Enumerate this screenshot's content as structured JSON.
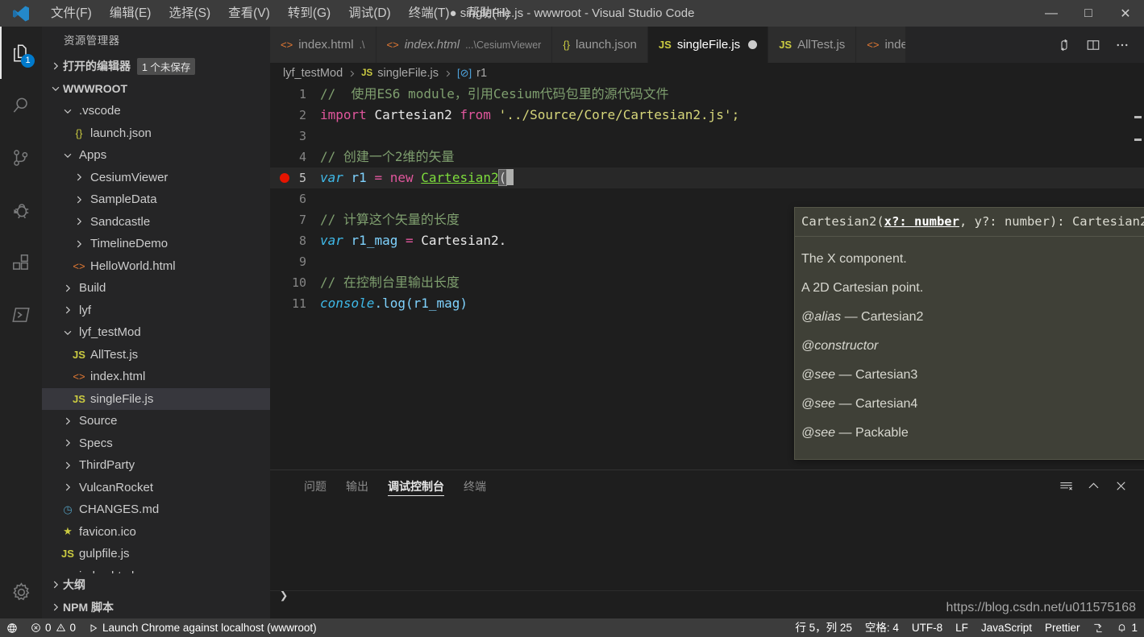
{
  "titlebar": {
    "logo": "vscode-logo",
    "menus": [
      "文件(F)",
      "编辑(E)",
      "选择(S)",
      "查看(V)",
      "转到(G)",
      "调试(D)",
      "终端(T)",
      "帮助(H)"
    ],
    "title": "● singleFile.js - wwwroot - Visual Studio Code",
    "window_controls": {
      "minimize": "—",
      "maximize": "□",
      "close": "✕"
    }
  },
  "activitybar": {
    "items": [
      {
        "name": "explorer",
        "icon": "files-icon",
        "active": true,
        "badge": "1"
      },
      {
        "name": "search",
        "icon": "search-icon",
        "active": false,
        "badge": ""
      },
      {
        "name": "source-control",
        "icon": "source-control-icon",
        "active": false,
        "badge": ""
      },
      {
        "name": "debug",
        "icon": "debug-icon",
        "active": false,
        "badge": ""
      },
      {
        "name": "extensions",
        "icon": "extensions-icon",
        "active": false,
        "badge": ""
      },
      {
        "name": "terminal-manager",
        "icon": "terminal-icon",
        "active": false,
        "badge": ""
      }
    ],
    "settings": {
      "name": "settings",
      "icon": "gear-icon"
    }
  },
  "sidebar": {
    "title": "资源管理器",
    "open_editors": {
      "label": "打开的编辑器",
      "badge": "1 个未保存",
      "expanded": false
    },
    "workspace": {
      "label": "WWWROOT",
      "expanded": true
    },
    "tree": [
      {
        "label": ".vscode",
        "indent": 1,
        "type": "folder",
        "expanded": true,
        "selected": false
      },
      {
        "label": "launch.json",
        "indent": 2,
        "type": "json",
        "expanded": null,
        "selected": false
      },
      {
        "label": "Apps",
        "indent": 1,
        "type": "folder",
        "expanded": true,
        "selected": false
      },
      {
        "label": "CesiumViewer",
        "indent": 2,
        "type": "folder",
        "expanded": false,
        "selected": false
      },
      {
        "label": "SampleData",
        "indent": 2,
        "type": "folder",
        "expanded": false,
        "selected": false
      },
      {
        "label": "Sandcastle",
        "indent": 2,
        "type": "folder",
        "expanded": false,
        "selected": false
      },
      {
        "label": "TimelineDemo",
        "indent": 2,
        "type": "folder",
        "expanded": false,
        "selected": false
      },
      {
        "label": "HelloWorld.html",
        "indent": 2,
        "type": "html",
        "expanded": null,
        "selected": false
      },
      {
        "label": "Build",
        "indent": 1,
        "type": "folder",
        "expanded": false,
        "selected": false
      },
      {
        "label": "lyf",
        "indent": 1,
        "type": "folder",
        "expanded": false,
        "selected": false
      },
      {
        "label": "lyf_testMod",
        "indent": 1,
        "type": "folder",
        "expanded": true,
        "selected": false
      },
      {
        "label": "AllTest.js",
        "indent": 2,
        "type": "js",
        "expanded": null,
        "selected": false
      },
      {
        "label": "index.html",
        "indent": 2,
        "type": "html",
        "expanded": null,
        "selected": false
      },
      {
        "label": "singleFile.js",
        "indent": 2,
        "type": "js",
        "expanded": null,
        "selected": true
      },
      {
        "label": "Source",
        "indent": 1,
        "type": "folder",
        "expanded": false,
        "selected": false
      },
      {
        "label": "Specs",
        "indent": 1,
        "type": "folder",
        "expanded": false,
        "selected": false
      },
      {
        "label": "ThirdParty",
        "indent": 1,
        "type": "folder",
        "expanded": false,
        "selected": false
      },
      {
        "label": "VulcanRocket",
        "indent": 1,
        "type": "folder",
        "expanded": false,
        "selected": false
      },
      {
        "label": "CHANGES.md",
        "indent": 1,
        "type": "md",
        "expanded": null,
        "selected": false
      },
      {
        "label": "favicon.ico",
        "indent": 1,
        "type": "star",
        "expanded": null,
        "selected": false
      },
      {
        "label": "gulpfile.js",
        "indent": 1,
        "type": "js",
        "expanded": null,
        "selected": false
      },
      {
        "label": "index.html",
        "indent": 1,
        "type": "html",
        "expanded": null,
        "selected": false
      }
    ],
    "bottom_sections": [
      {
        "label": "大纲",
        "has_chevron_right": false
      },
      {
        "label": "NPM 脚本",
        "has_chevron_right": true
      }
    ]
  },
  "editor": {
    "tabs": [
      {
        "name": "index.html",
        "sub": ".\\",
        "icon": "html-icon",
        "active": false,
        "dirty": false,
        "italic": false
      },
      {
        "name": "index.html",
        "sub": "...\\CesiumViewer",
        "icon": "html-icon",
        "active": false,
        "dirty": false,
        "italic": true
      },
      {
        "name": "launch.json",
        "sub": "",
        "icon": "json-icon",
        "active": false,
        "dirty": false,
        "italic": false
      },
      {
        "name": "singleFile.js",
        "sub": "",
        "icon": "js-icon",
        "active": true,
        "dirty": true,
        "italic": false
      },
      {
        "name": "AllTest.js",
        "sub": "",
        "icon": "js-icon",
        "active": false,
        "dirty": false,
        "italic": false
      },
      {
        "name": "inde",
        "sub": "",
        "icon": "html-icon",
        "active": false,
        "dirty": false,
        "italic": false
      }
    ],
    "tab_actions": [
      {
        "name": "split-in-group-icon",
        "glyph": "⤵"
      },
      {
        "name": "split-editor-icon",
        "glyph": "▯▯"
      },
      {
        "name": "more-actions-icon",
        "glyph": "···"
      }
    ],
    "breadcrumbs": [
      "lyf_testMod",
      "singleFile.js",
      "r1"
    ],
    "lines": [
      {
        "n": 1,
        "current": false,
        "breakpoint": false
      },
      {
        "n": 2,
        "current": false,
        "breakpoint": false
      },
      {
        "n": 3,
        "current": false,
        "breakpoint": false
      },
      {
        "n": 4,
        "current": false,
        "breakpoint": false
      },
      {
        "n": 5,
        "current": true,
        "breakpoint": true
      },
      {
        "n": 6,
        "current": false,
        "breakpoint": false
      },
      {
        "n": 7,
        "current": false,
        "breakpoint": false
      },
      {
        "n": 8,
        "current": false,
        "breakpoint": false
      },
      {
        "n": 9,
        "current": false,
        "breakpoint": false
      },
      {
        "n": 10,
        "current": false,
        "breakpoint": false
      },
      {
        "n": 11,
        "current": false,
        "breakpoint": false
      }
    ],
    "code": {
      "l1_comment": "//  使用ES6 module，引用Cesium代码包里的源代码文件",
      "l2_import": "import",
      "l2_name": "Cartesian2",
      "l2_from": "from",
      "l2_path": "'../Source/Core/Cartesian2.js';",
      "l4_comment": "// 创建一个2维的矢量",
      "l5_var": "var",
      "l5_ident": "r1",
      "l5_eq": "=",
      "l5_new": "new",
      "l5_class": "Cartesian2",
      "l5_open": "(",
      "l5_close": ")",
      "l7_comment": "// 计算这个矢量的长度",
      "l8_var": "var",
      "l8_ident": "r1_mag",
      "l8_eq": "=",
      "l8_rest": "Cartesian2.",
      "l10_comment": "// 在控制台里输出长度",
      "l11_obj": "console",
      "l11_rest": ".log(r1_mag)"
    },
    "signature_help": {
      "signature_prefix": "Cartesian2(",
      "param_active": "x?: number",
      "signature_mid": ", y?: number): ",
      "signature_return": "Cartesian2",
      "doc_lines": [
        {
          "text": "The X component.",
          "tag": ""
        },
        {
          "text": "A 2D Cartesian point.",
          "tag": ""
        },
        {
          "text": " — Cartesian2",
          "tag": "@alias"
        },
        {
          "text": "",
          "tag": "@constructor"
        },
        {
          "text": " — Cartesian3",
          "tag": "@see"
        },
        {
          "text": " — Cartesian4",
          "tag": "@see"
        },
        {
          "text": " — Packable",
          "tag": "@see"
        }
      ]
    }
  },
  "panel": {
    "tabs": [
      {
        "label": "问题",
        "active": false
      },
      {
        "label": "输出",
        "active": false
      },
      {
        "label": "调试控制台",
        "active": true
      },
      {
        "label": "终端",
        "active": false
      }
    ],
    "actions": [
      {
        "name": "clear-console-icon",
        "glyph": "clear"
      },
      {
        "name": "maximize-panel-icon",
        "glyph": "chevron-up"
      },
      {
        "name": "close-panel-icon",
        "glyph": "close"
      }
    ],
    "repl_prompt": "❯"
  },
  "statusbar": {
    "left": [
      {
        "name": "remote-indicator",
        "label": "",
        "icon": "remote-icon"
      },
      {
        "name": "problems",
        "label": "0",
        "icon": "error-icon"
      },
      {
        "name": "warnings",
        "label": "0",
        "icon": "warning-icon"
      },
      {
        "name": "launch-config",
        "label": "Launch Chrome against localhost (wwwroot)",
        "icon": "play-icon"
      }
    ],
    "right": [
      {
        "name": "cursor-position",
        "label": "行 5，列 25"
      },
      {
        "name": "indentation",
        "label": "空格: 4"
      },
      {
        "name": "encoding",
        "label": "UTF-8"
      },
      {
        "name": "eol",
        "label": "LF"
      },
      {
        "name": "language-mode",
        "label": "JavaScript"
      },
      {
        "name": "formatter",
        "label": "Prettier"
      },
      {
        "name": "live-share",
        "label": ""
      },
      {
        "name": "notifications",
        "label": "1"
      }
    ]
  },
  "watermark": {
    "text": "https://blog.csdn.net/u011575168"
  },
  "colors": {
    "accent_blue": "#007acc",
    "titlebar_bg": "#3c3c3c",
    "activitybar_bg": "#222222",
    "sidebar_bg": "#252526",
    "editor_bg": "#1e1e1e",
    "tab_active_bg": "#1e1e1e",
    "tab_inactive_bg": "#2d2d2d",
    "selection_bg": "#37373d",
    "breakpoint_red": "#e51400",
    "tooltip_bg": "#3f4037",
    "comment_green": "#7f9f6f",
    "keyword_magenta": "#e0569c",
    "string_yellow": "#d6d67a",
    "type_lime": "#7ddc3c",
    "ident_cyan": "#3fb9e8",
    "js_icon_yellow": "#cbcb41",
    "html_icon_orange": "#e37933"
  }
}
